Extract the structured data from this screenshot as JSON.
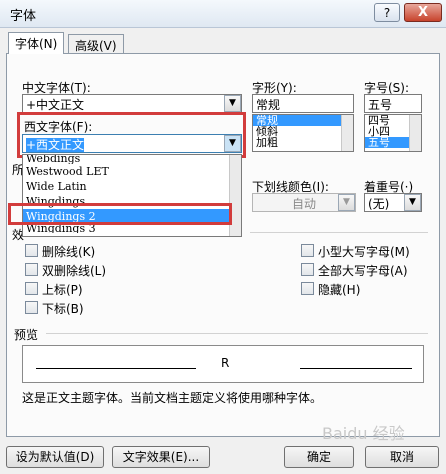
{
  "window": {
    "title": "字体",
    "help_label": "?",
    "close_label": "X"
  },
  "tabs": [
    {
      "label": "字体(N)",
      "active": true
    },
    {
      "label": "高级(V)",
      "active": false
    }
  ],
  "zh_font": {
    "label": "中文字体(T):",
    "value": "+中文正文"
  },
  "west_font": {
    "label": "西文字体(F):",
    "value": "+西文正文"
  },
  "font_list": {
    "items": [
      "Webdings",
      "Westwood LET",
      "Wide Latin",
      "Wingdings",
      "Wingdings 2",
      "Wingdings 3"
    ],
    "selected": "Wingdings 2"
  },
  "style": {
    "label": "字形(Y):",
    "value": "常规",
    "options": [
      "常规",
      "倾斜",
      "加粗"
    ],
    "selected": "常规"
  },
  "size": {
    "label": "字号(S):",
    "value": "五号",
    "options": [
      "四号",
      "小四",
      "五号"
    ],
    "selected": "五号"
  },
  "partial_labels": {
    "all_text_fragment": "所",
    "effects_fragment": "效"
  },
  "underline_color": {
    "label": "下划线颜色(I):",
    "value": "自动"
  },
  "emphasis": {
    "label": "着重号(·)",
    "value": "(无)"
  },
  "effects_left": [
    "删除线(K)",
    "双删除线(L)",
    "上标(P)",
    "下标(B)"
  ],
  "effects_right": [
    "小型大写字母(M)",
    "全部大写字母(A)",
    "隐藏(H)"
  ],
  "preview": {
    "label": "预览",
    "sample": "R",
    "note": "这是正文主题字体。当前文档主题定义将使用哪种字体。"
  },
  "buttons": {
    "default": "设为默认值(D)",
    "text_effects": "文字效果(E)...",
    "ok": "确定",
    "cancel": "取消"
  },
  "watermark": "Baidu 经验"
}
